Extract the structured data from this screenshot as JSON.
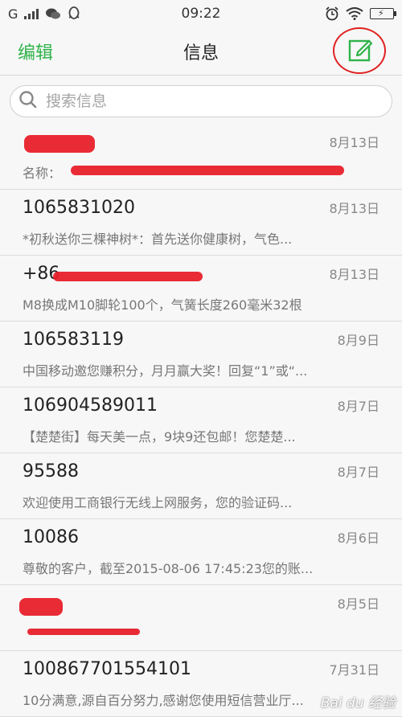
{
  "status_bar": {
    "carrier": "G",
    "time": "09:22"
  },
  "nav": {
    "edit_label": "编辑",
    "title": "信息"
  },
  "search": {
    "placeholder": "搜索信息"
  },
  "messages": [
    {
      "name": "",
      "date": "8月13日",
      "preview": "名称：",
      "redacted": true
    },
    {
      "name": "1065831020",
      "date": "8月13日",
      "preview": "*初秋送你三棵神树*：首先送你健康树，气色..."
    },
    {
      "name": "+86",
      "date": "8月13日",
      "preview": "M8换成M10脚轮100个，气簧长度260毫米32根",
      "redacted": true
    },
    {
      "name": "106583119",
      "date": "8月9日",
      "preview": "中国移动邀您赚积分，月月赢大奖！回复“1”或“..."
    },
    {
      "name": "106904589011",
      "date": "8月7日",
      "preview": "【楚楚街】每天美一点，9块9还包邮！您楚楚..."
    },
    {
      "name": "95588",
      "date": "8月7日",
      "preview": "欢迎使用工商银行无线上网服务，您的验证码..."
    },
    {
      "name": "10086",
      "date": "8月6日",
      "preview": "尊敬的客户，截至2015-08-06 17:45:23您的账..."
    },
    {
      "name": "",
      "date": "8月5日",
      "preview": "",
      "redacted": true
    },
    {
      "name": "10086770155410​1",
      "date": "7月31日",
      "preview": "10分满意,源自百分努力,感谢您使用短信营业厅..."
    }
  ],
  "watermark": "Bai du 经验",
  "colors": {
    "accent_green": "#2fb34a",
    "annotation_red": "#e02020"
  },
  "icons": [
    "signal-icon",
    "wechat-icon",
    "qq-icon",
    "alarm-icon",
    "wifi-icon",
    "battery-icon",
    "compose-icon",
    "search-icon"
  ]
}
